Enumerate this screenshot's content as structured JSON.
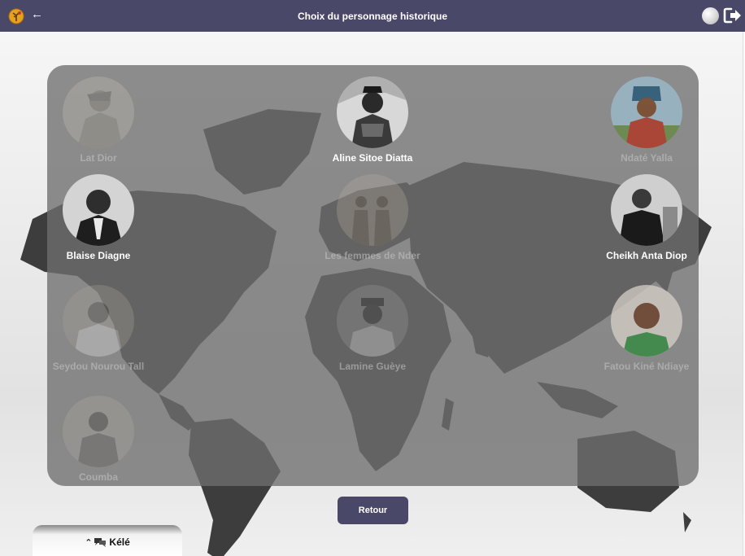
{
  "header": {
    "title": "Choix du personnage historique",
    "back_icon": "arrow-left-icon",
    "logo_icon": "baobab-globe-logo-icon",
    "globe_icon": "globe-language-icon",
    "logout_icon": "logout-icon"
  },
  "colors": {
    "header_bg": "#4a4868",
    "panel_bg": "rgba(110,110,110,0.78)",
    "button_bg": "#4a4868"
  },
  "characters": [
    {
      "name": "Lat Dior",
      "locked": true
    },
    {
      "name": "Aline Sitoe Diatta",
      "locked": false
    },
    {
      "name": "Ndaté Yalla",
      "locked": true
    },
    {
      "name": "Blaise Diagne",
      "locked": false
    },
    {
      "name": "Les femmes de Nder",
      "locked": true
    },
    {
      "name": "Cheikh Anta Diop",
      "locked": false
    },
    {
      "name": "Seydou Nourou Tall",
      "locked": true
    },
    {
      "name": "Lamine Guèye",
      "locked": true
    },
    {
      "name": "Fatou Kiné Ndiaye",
      "locked": true
    },
    {
      "name": "Coumba",
      "locked": true
    }
  ],
  "footer": {
    "back_button": "Retour",
    "chat_tab_label": "Kélé",
    "chat_tab_icons": [
      "chevron-up-icon",
      "chat-bubbles-icon"
    ]
  }
}
